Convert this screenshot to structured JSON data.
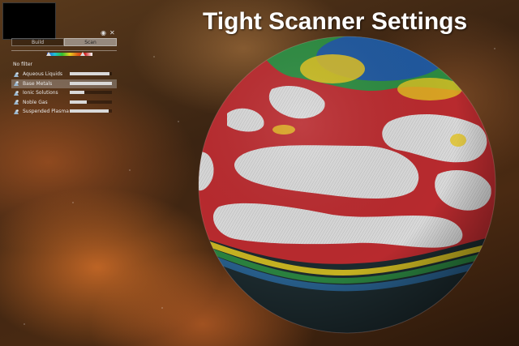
{
  "title": "Tight Scanner Settings",
  "panel": {
    "tabs": [
      {
        "label": "Build",
        "active": false
      },
      {
        "label": "Scan",
        "active": true
      }
    ],
    "filter_label": "No filter",
    "spectrum": {
      "low_handle": 0.35,
      "high_handle": 0.68
    },
    "resources": [
      {
        "name": "Aqueous Liquids",
        "level": 0.95,
        "selected": false,
        "icon": "aqueous-liquids-icon"
      },
      {
        "name": "Base Metals",
        "level": 1.0,
        "selected": true,
        "icon": "base-metals-icon"
      },
      {
        "name": "Ionic Solutions",
        "level": 0.35,
        "selected": false,
        "icon": "ionic-solutions-icon"
      },
      {
        "name": "Noble Gas",
        "level": 0.4,
        "selected": false,
        "icon": "noble-gas-icon"
      },
      {
        "name": "Suspended Plasma",
        "level": 0.92,
        "selected": false,
        "icon": "suspended-plasma-icon"
      }
    ]
  },
  "colors": {
    "heat_high": "#c82a2a",
    "heat_mid": "#e0c020",
    "heat_low": "#2a8a3a",
    "heat_deep": "#1f3fae",
    "surface": "#dcdcdc"
  }
}
